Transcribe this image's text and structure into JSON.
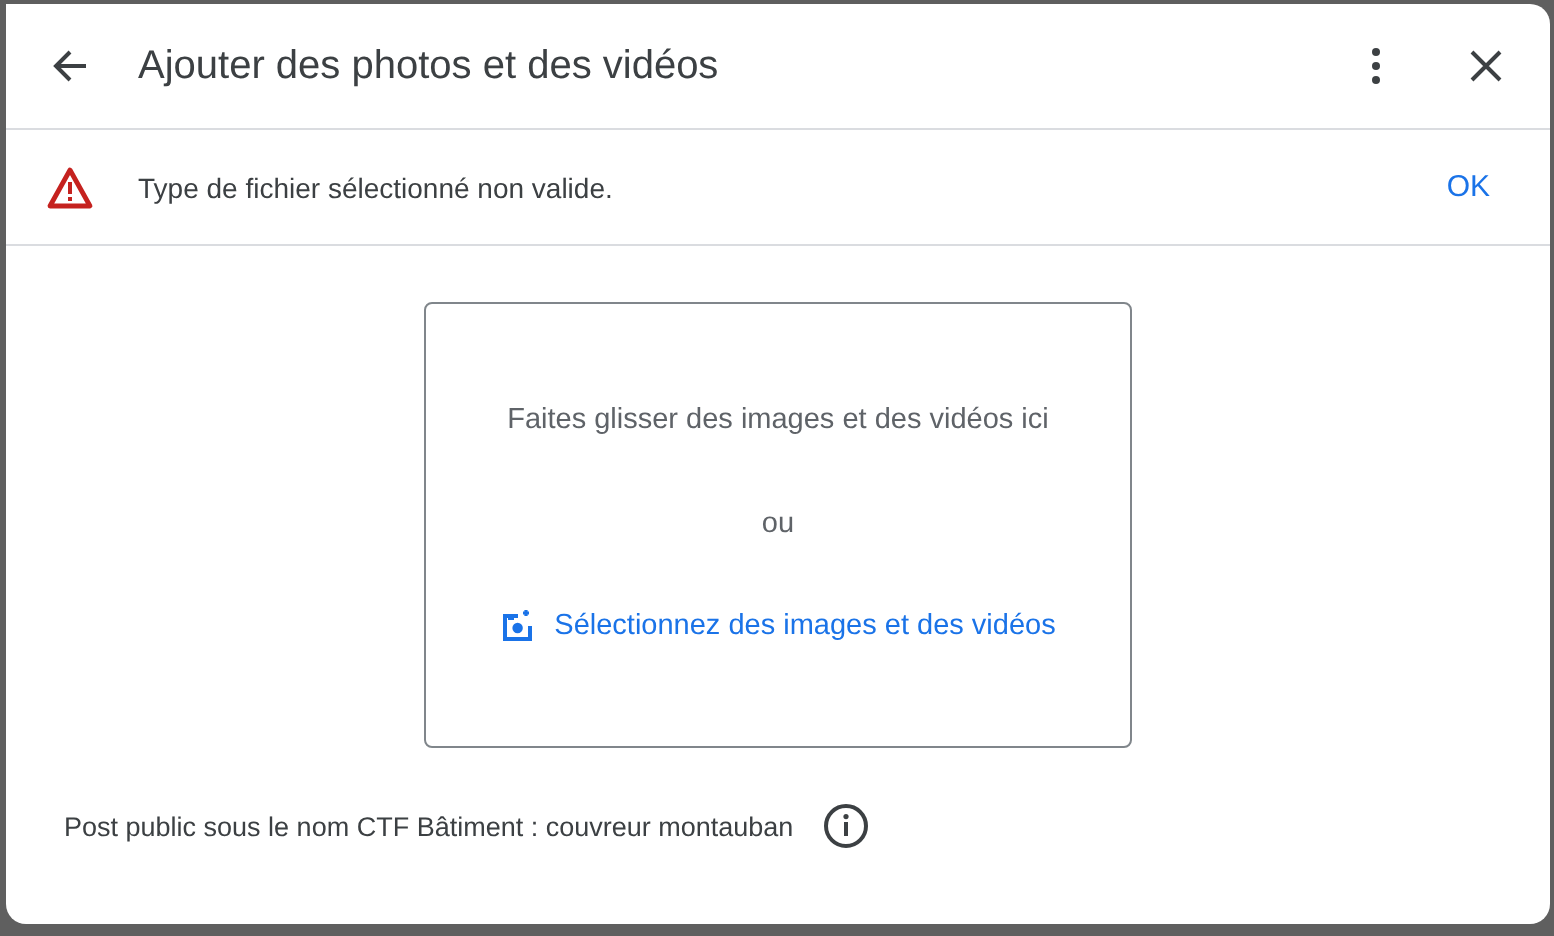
{
  "dialog": {
    "title": "Ajouter des photos et des vidéos"
  },
  "alert": {
    "message": "Type de fichier sélectionné non valide.",
    "action": "OK"
  },
  "dropzone": {
    "hint": "Faites glisser des images et des vidéos ici",
    "separator": "ou",
    "select_link": "Sélectionnez des images et des vidéos"
  },
  "footer": {
    "text": "Post public sous le nom CTF Bâtiment : couvreur montauban"
  }
}
